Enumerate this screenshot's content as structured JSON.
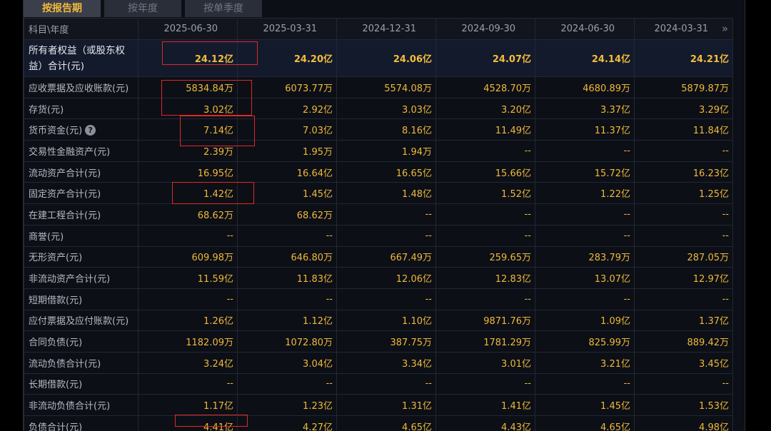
{
  "tabs": [
    {
      "label": "按报告期",
      "active": true
    },
    {
      "label": "按年度",
      "active": false
    },
    {
      "label": "按单季度",
      "active": false
    }
  ],
  "header": {
    "first": "科目\\年度",
    "periods": [
      "2025-06-30",
      "2025-03-31",
      "2024-12-31",
      "2024-09-30",
      "2024-06-30",
      "2024-03-31"
    ],
    "next_icon": "»"
  },
  "help_icon": "?",
  "rows": [
    {
      "label": "所有者权益（或股东权益）合计(元)",
      "values": [
        "24.12亿",
        "24.20亿",
        "24.06亿",
        "24.07亿",
        "24.14亿",
        "24.21亿"
      ]
    },
    {
      "label": "应收票据及应收账款(元)",
      "values": [
        "5834.84万",
        "6073.77万",
        "5574.08万",
        "4528.70万",
        "4680.89万",
        "5879.87万"
      ]
    },
    {
      "label": "存货(元)",
      "values": [
        "3.02亿",
        "2.92亿",
        "3.03亿",
        "3.20亿",
        "3.37亿",
        "3.29亿"
      ]
    },
    {
      "label": "货币资金(元)",
      "values": [
        "7.14亿",
        "7.03亿",
        "8.16亿",
        "11.49亿",
        "11.37亿",
        "11.84亿"
      ]
    },
    {
      "label": "交易性金融资产(元)",
      "values": [
        "2.39万",
        "1.95万",
        "1.94万",
        "--",
        "--",
        "--"
      ]
    },
    {
      "label": "流动资产合计(元)",
      "values": [
        "16.95亿",
        "16.64亿",
        "16.65亿",
        "15.66亿",
        "15.72亿",
        "16.23亿"
      ]
    },
    {
      "label": "固定资产合计(元)",
      "values": [
        "1.42亿",
        "1.45亿",
        "1.48亿",
        "1.52亿",
        "1.22亿",
        "1.25亿"
      ]
    },
    {
      "label": "在建工程合计(元)",
      "values": [
        "68.62万",
        "68.62万",
        "--",
        "--",
        "--",
        "--"
      ]
    },
    {
      "label": "商誉(元)",
      "values": [
        "--",
        "--",
        "--",
        "--",
        "--",
        "--"
      ]
    },
    {
      "label": "无形资产(元)",
      "values": [
        "609.98万",
        "646.80万",
        "667.49万",
        "259.65万",
        "283.79万",
        "287.05万"
      ]
    },
    {
      "label": "非流动资产合计(元)",
      "values": [
        "11.59亿",
        "11.83亿",
        "12.06亿",
        "12.83亿",
        "13.07亿",
        "12.97亿"
      ]
    },
    {
      "label": "短期借款(元)",
      "values": [
        "--",
        "--",
        "--",
        "--",
        "--",
        "--"
      ]
    },
    {
      "label": "应付票据及应付账款(元)",
      "values": [
        "1.26亿",
        "1.12亿",
        "1.10亿",
        "9871.76万",
        "1.09亿",
        "1.37亿"
      ]
    },
    {
      "label": "合同负债(元)",
      "values": [
        "1182.09万",
        "1072.80万",
        "387.75万",
        "1781.29万",
        "825.99万",
        "889.42万"
      ]
    },
    {
      "label": "流动负债合计(元)",
      "values": [
        "3.24亿",
        "3.04亿",
        "3.34亿",
        "3.01亿",
        "3.21亿",
        "3.45亿"
      ]
    },
    {
      "label": "长期借款(元)",
      "values": [
        "--",
        "--",
        "--",
        "--",
        "--",
        "--"
      ]
    },
    {
      "label": "非流动负债合计(元)",
      "values": [
        "1.17亿",
        "1.23亿",
        "1.31亿",
        "1.41亿",
        "1.45亿",
        "1.53亿"
      ]
    },
    {
      "label": "负债合计(元)",
      "values": [
        "4.41亿",
        "4.27亿",
        "4.65亿",
        "4.43亿",
        "4.65亿",
        "4.98亿"
      ]
    }
  ],
  "colors": {
    "background": "#0c0f16",
    "value": "#f0b93a",
    "label": "#b6bac4",
    "highlight": "#e02828"
  }
}
